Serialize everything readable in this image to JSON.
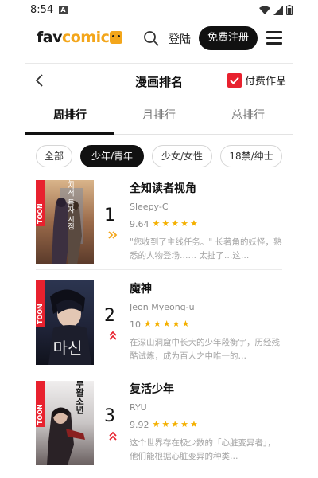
{
  "status_bar": {
    "time": "8:54",
    "notification_glyph": "A"
  },
  "header": {
    "logo_part1": "fav",
    "logo_part2": "comic",
    "login_label": "登陆",
    "register_label": "免费注册"
  },
  "title_bar": {
    "title": "漫画排名",
    "paid_label": "付费作品",
    "paid_checked": true,
    "accent_color": "#e8212e"
  },
  "tabs": [
    {
      "label": "周排行",
      "active": true
    },
    {
      "label": "月排行",
      "active": false
    },
    {
      "label": "总排行",
      "active": false
    }
  ],
  "filters": [
    {
      "label": "全部",
      "active": false
    },
    {
      "label": "少年/青年",
      "active": true
    },
    {
      "label": "少女/女性",
      "active": false
    },
    {
      "label": "18禁/绅士",
      "active": false
    }
  ],
  "rankings": [
    {
      "rank": "1",
      "trend_icon": "double-chevron-right-icon",
      "trend_color": "#f3a61b",
      "title": "全知读者视角",
      "author": "Sleepy-C",
      "score": "9.64",
      "stars": 5,
      "description": "\"您收到了主线任务。\" 长著角的妖怪，熟悉的人物登场…… 太扯了…这…",
      "cover_badge": "TOON",
      "cover_text": "전지적 독자 시점"
    },
    {
      "rank": "2",
      "trend_icon": "double-chevron-up-icon",
      "trend_color": "#e8212e",
      "title": "魔神",
      "author": "Jeon Myeong-u",
      "score": "10",
      "stars": 5,
      "description": "在深山洞窟中长大的少年段衡宇，历经残酷试炼，成为百人之中唯一的…",
      "cover_badge": "TOON",
      "cover_text": "마신"
    },
    {
      "rank": "3",
      "trend_icon": "double-chevron-up-icon",
      "trend_color": "#e8212e",
      "title": "复活少年",
      "author": "RYU",
      "score": "9.92",
      "stars": 5,
      "description": "这个世界存在极少数的「心脏变异者」，他们能根据心脏变异的种类…",
      "cover_badge": "TOON",
      "cover_text": "부활소년"
    }
  ]
}
